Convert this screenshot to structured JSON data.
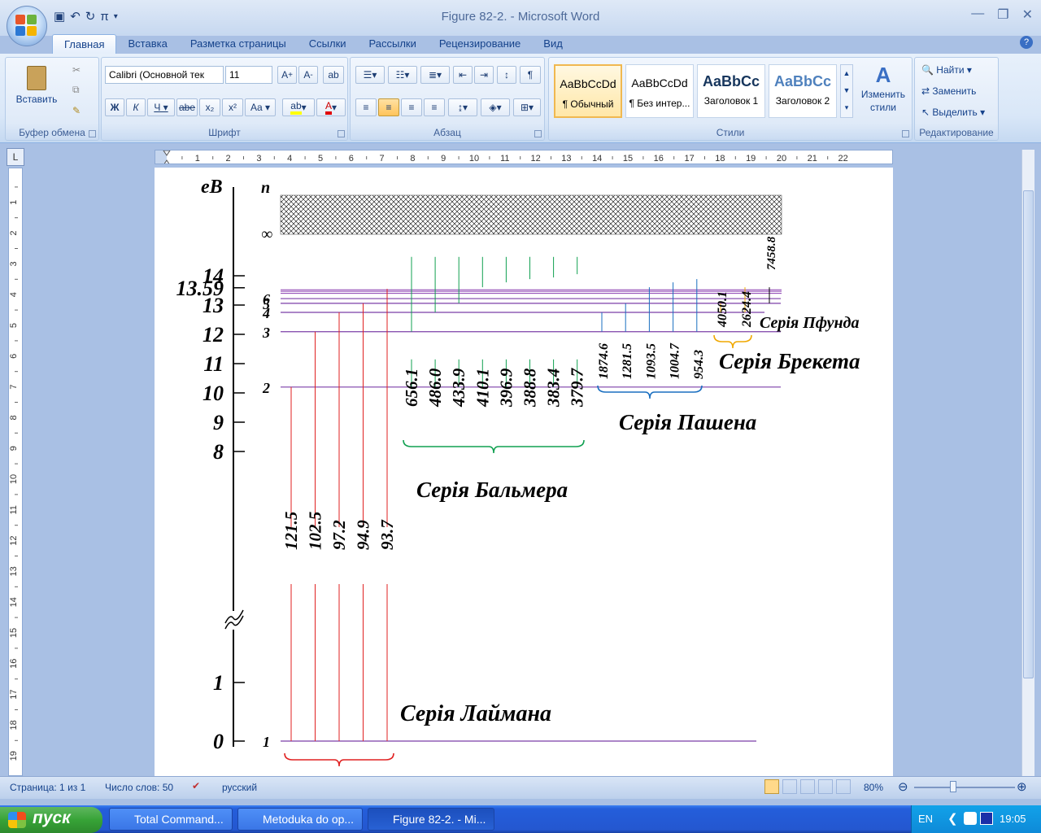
{
  "window": {
    "title": "Figure 82-2. - Microsoft Word"
  },
  "tabs": [
    "Главная",
    "Вставка",
    "Разметка страницы",
    "Ссылки",
    "Рассылки",
    "Рецензирование",
    "Вид"
  ],
  "ribbon": {
    "clipboard": {
      "label": "Буфер обмена",
      "paste": "Вставить"
    },
    "font": {
      "label": "Шрифт",
      "family": "Calibri (Основной тек",
      "size": "11"
    },
    "paragraph": {
      "label": "Абзац"
    },
    "styles": {
      "label": "Стили",
      "items": [
        {
          "sample": "AaBbCcDd",
          "name": "¶ Обычный"
        },
        {
          "sample": "AaBbCcDd",
          "name": "¶ Без интер..."
        },
        {
          "sample": "AaBbCc",
          "name": "Заголовок 1"
        },
        {
          "sample": "AaBbCc",
          "name": "Заголовок 2"
        }
      ],
      "change": "Изменить стили"
    },
    "editing": {
      "label": "Редактирование",
      "find": "Найти",
      "replace": "Заменить",
      "select": "Выделить"
    }
  },
  "figure": {
    "axis_label": "eB",
    "n_label": "n",
    "infinity": "∞",
    "energy_ticks": [
      {
        "label": "14",
        "value": 14
      },
      {
        "label": "13.59",
        "value": 13.59
      },
      {
        "label": "13",
        "value": 13
      },
      {
        "label": "12",
        "value": 12
      },
      {
        "label": "11",
        "value": 11
      },
      {
        "label": "10",
        "value": 10
      },
      {
        "label": "9",
        "value": 9
      },
      {
        "label": "8",
        "value": 8
      },
      {
        "label": "1",
        "value": 1
      },
      {
        "label": "0",
        "value": 0
      }
    ],
    "levels": [
      {
        "n": "1",
        "energy": 0
      },
      {
        "n": "2",
        "energy": 10.2
      },
      {
        "n": "3",
        "energy": 12.09
      },
      {
        "n": "4",
        "energy": 12.75
      },
      {
        "n": "5",
        "energy": 13.06
      },
      {
        "n": "6",
        "energy": 13.22
      }
    ],
    "series": [
      {
        "name": "Серія Лаймана",
        "color": "#e02020",
        "lower_n": 1,
        "wavelengths": [
          "121.5",
          "102.5",
          "97.2",
          "94.9",
          "93.7"
        ]
      },
      {
        "name": "Серія Бальмера",
        "color": "#10a050",
        "lower_n": 2,
        "wavelengths": [
          "656.1",
          "486.0",
          "433.9",
          "410.1",
          "396.9",
          "388.8",
          "383.4",
          "379.7"
        ]
      },
      {
        "name": "Серія Пашена",
        "color": "#1a6fc0",
        "lower_n": 3,
        "wavelengths": [
          "1874.6",
          "1281.5",
          "1093.5",
          "1004.7",
          "954.3"
        ]
      },
      {
        "name": "Серія Брекета",
        "color": "#f0a800",
        "lower_n": 4,
        "wavelengths": [
          "4050.1",
          "2624.4"
        ]
      },
      {
        "name": "Серія Пфунда",
        "color": "#000000",
        "lower_n": 5,
        "wavelengths": [
          "7458.8"
        ]
      }
    ]
  },
  "status": {
    "page": "Страница: 1 из 1",
    "words": "Число слов: 50",
    "language": "русский",
    "zoom": "80%"
  },
  "taskbar": {
    "start": "пуск",
    "tasks": [
      "Total Command...",
      "Metoduka do op...",
      "Figure 82-2. - Mi..."
    ],
    "lang": "EN",
    "clock": "19:05"
  }
}
